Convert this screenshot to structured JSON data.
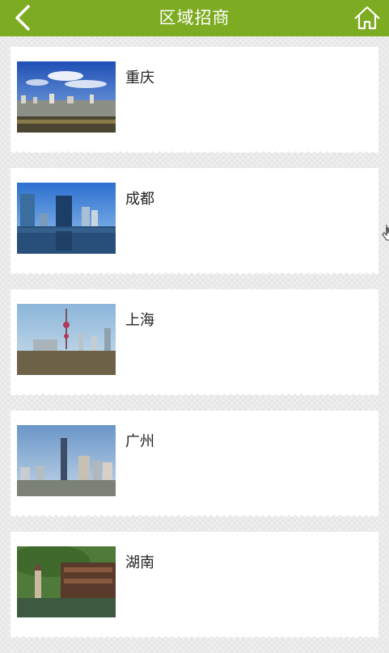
{
  "header": {
    "title": "区域招商",
    "accent_color": "#7dab21",
    "back_icon": "chevron-left-icon",
    "home_icon": "home-icon"
  },
  "regions": [
    {
      "name": "重庆"
    },
    {
      "name": "成都"
    },
    {
      "name": "上海"
    },
    {
      "name": "广州"
    },
    {
      "name": "湖南"
    }
  ]
}
